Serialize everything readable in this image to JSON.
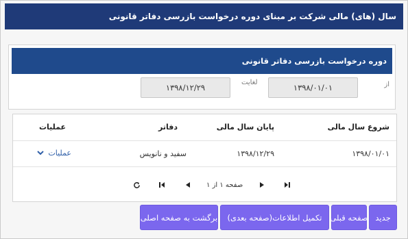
{
  "header": {
    "title": "سال (های) مالی شرکت بر مبنای دوره درخواست بازرسی دفاتر قانونی"
  },
  "period_panel": {
    "title": "دوره درخواست بازرسی دفاتر قانونی",
    "from_label": "از",
    "from_value": "۱۳۹۸/۰۱/۰۱",
    "to_label": "لغایت",
    "to_value": "۱۳۹۸/۱۲/۲۹"
  },
  "table": {
    "columns": [
      "شروع سال مالی",
      "پایان سال مالی",
      "دفاتر",
      "عملیات"
    ],
    "rows": [
      {
        "start": "۱۳۹۸/۰۱/۰۱",
        "end": "۱۳۹۸/۱۲/۲۹",
        "books": "سفید و نانویس",
        "actions": "عملیات"
      }
    ]
  },
  "pager": {
    "text": "صفحه ۱ از ۱"
  },
  "buttons": {
    "new": "جدید",
    "prev_page": "صفحه قبلی",
    "complete": "تکمیل اطلاعات(صفحه بعدی)",
    "back": "برگشت به صفحه اصلی"
  },
  "colors": {
    "header_bg": "#1f3a78",
    "panel_header_bg": "#1f4a8c",
    "button_bg": "#7b67ee",
    "link": "#2f5fa8"
  }
}
